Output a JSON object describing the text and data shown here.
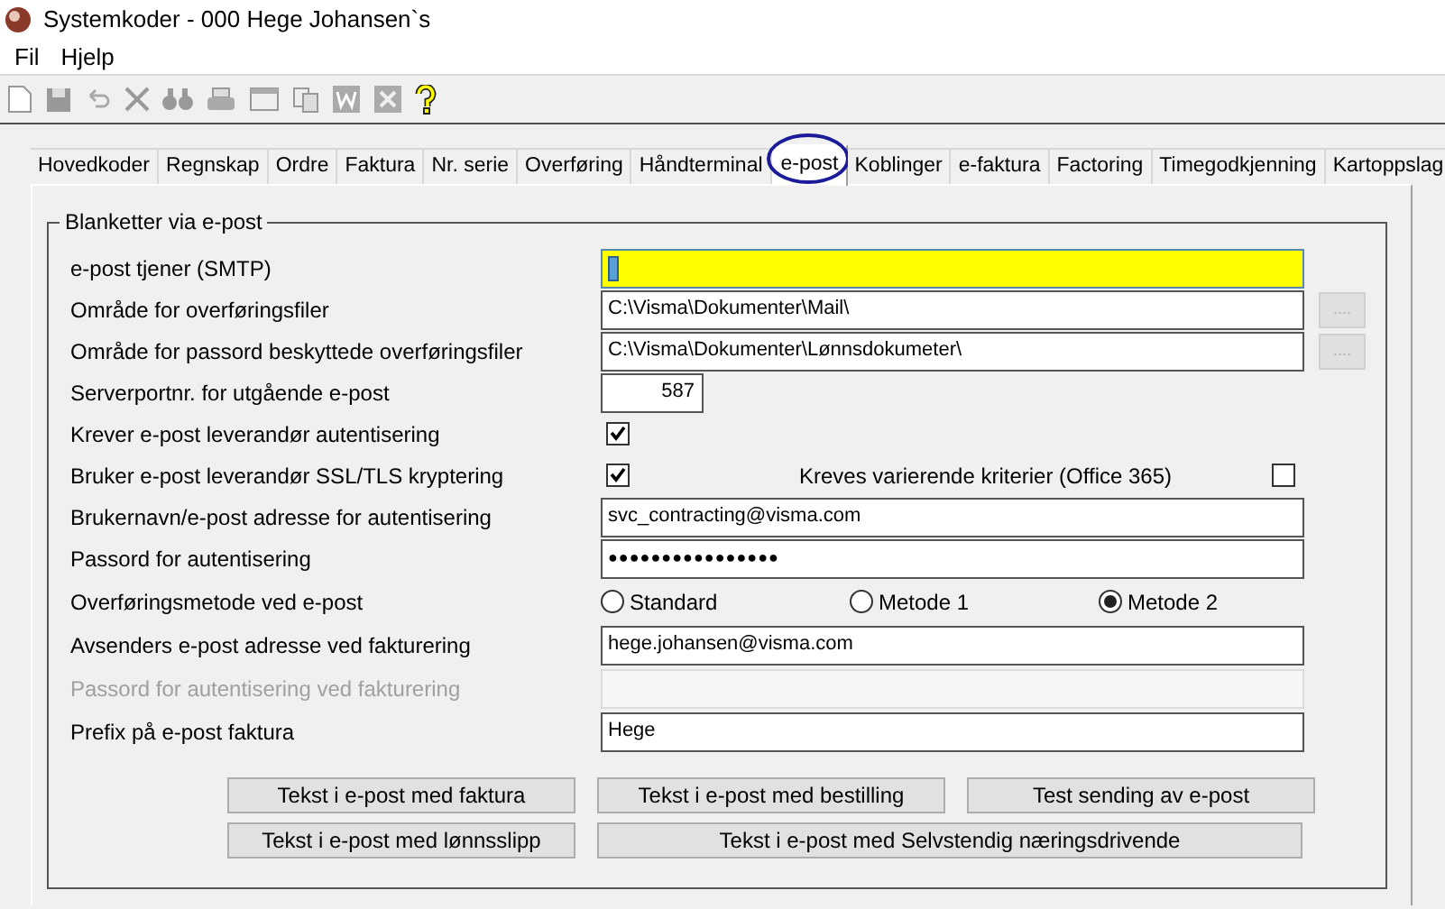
{
  "window": {
    "title": "Systemkoder - 000 Hege Johansen`s"
  },
  "menu": [
    "Fil",
    "Hjelp"
  ],
  "tabs": [
    {
      "label": "Hovedkoder",
      "selected": false
    },
    {
      "label": "Regnskap",
      "selected": false
    },
    {
      "label": "Ordre",
      "selected": false
    },
    {
      "label": "Faktura",
      "selected": false
    },
    {
      "label": "Nr. serie",
      "selected": false
    },
    {
      "label": "Overføring",
      "selected": false
    },
    {
      "label": "Håndterminal",
      "selected": false
    },
    {
      "label": "e-post",
      "selected": true
    },
    {
      "label": "Koblinger",
      "selected": false
    },
    {
      "label": "e-faktura",
      "selected": false
    },
    {
      "label": "Factoring",
      "selected": false
    },
    {
      "label": "Timegodkjenning",
      "selected": false
    },
    {
      "label": "Kartoppslag",
      "selected": false
    }
  ],
  "group": {
    "title": "Blanketter via e-post",
    "rows": [
      {
        "kind": "text",
        "label": "e-post tjener (SMTP)",
        "value": "",
        "focused": true
      },
      {
        "kind": "text",
        "label": "Område for overføringsfiler",
        "value": "C:\\Visma\\Dokumenter\\Mail\\",
        "browse": "...."
      },
      {
        "kind": "text",
        "label": "Område for passord beskyttede overføringsfiler",
        "value": "C:\\Visma\\Dokumenter\\Lønnsdokumeter\\",
        "browse": "...."
      },
      {
        "kind": "number",
        "label": "Serverportnr. for utgående e-post",
        "value": "587"
      },
      {
        "kind": "checkbox",
        "label": "Krever e-post leverandør autentisering",
        "checked": true
      },
      {
        "kind": "checkbox",
        "label": "Bruker e-post leverandør SSL/TLS kryptering",
        "checked": true,
        "extra": {
          "label": "Kreves varierende kriterier (Office 365)",
          "checked": false
        }
      },
      {
        "kind": "text",
        "label": "Brukernavn/e-post adresse for autentisering",
        "value": "svc_contracting@visma.com"
      },
      {
        "kind": "text",
        "label": "Passord for autentisering",
        "value": "●●●●●●●●●●●●●●●●"
      },
      {
        "kind": "radio",
        "label": "Overføringsmetode ved e-post",
        "options": [
          {
            "label": "Standard",
            "selected": false
          },
          {
            "label": "Metode 1",
            "selected": false
          },
          {
            "label": "Metode 2",
            "selected": true
          }
        ]
      },
      {
        "kind": "text",
        "label": "Avsenders e-post adresse ved fakturering",
        "value": "hege.johansen@visma.com"
      },
      {
        "kind": "text",
        "label": "Passord for autentisering ved fakturering",
        "value": "",
        "disabled": true
      },
      {
        "kind": "text",
        "label": "Prefix på e-post faktura",
        "value": "Hege"
      }
    ],
    "buttons": [
      [
        "Tekst i e-post med faktura",
        "Tekst i e-post med bestilling",
        "Test sending av e-post"
      ],
      [
        "Tekst i e-post med lønnsslipp",
        "Tekst i e-post med Selvstendig næringsdrivende"
      ]
    ]
  }
}
